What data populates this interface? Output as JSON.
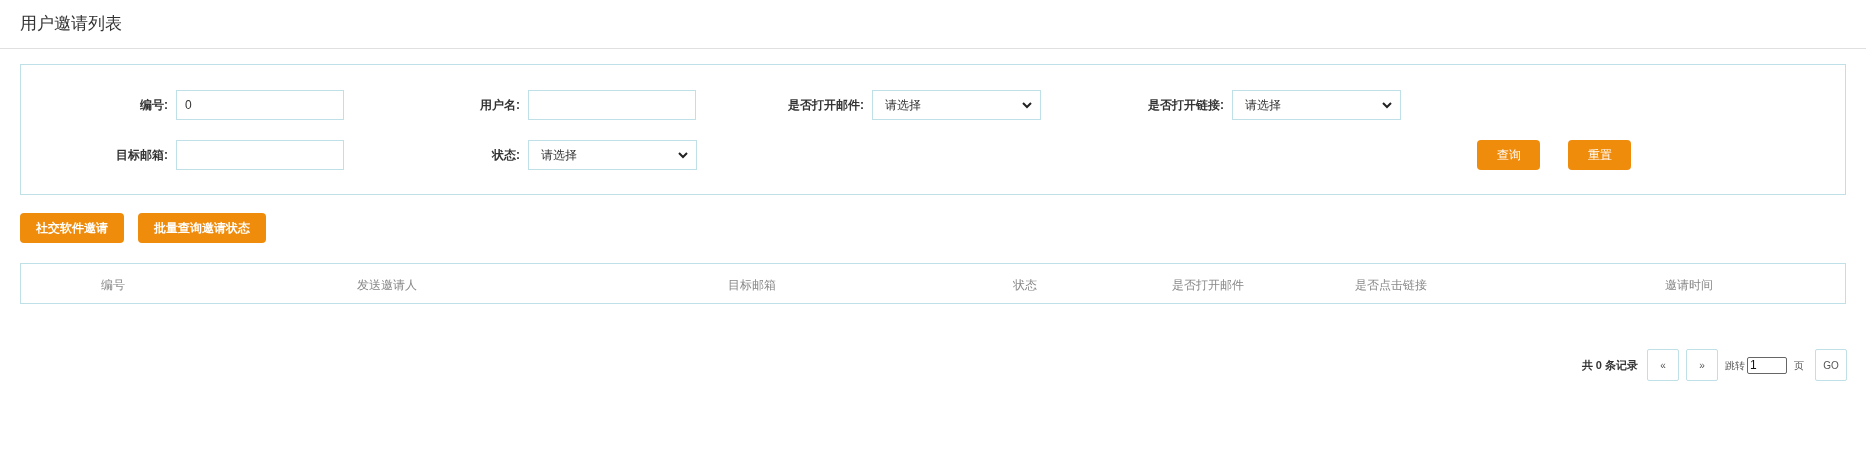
{
  "page_title": "用户邀请列表",
  "filters": [
    {
      "kind": "text",
      "label": "编号:",
      "value": "0"
    },
    {
      "kind": "text",
      "label": "用户名:"
    },
    {
      "kind": "select",
      "label": "是否打开邮件:",
      "value": "请选择"
    },
    {
      "kind": "select",
      "label": "是否打开链接:",
      "value": "请选择"
    },
    {
      "kind": "text",
      "label": "目标邮箱:"
    },
    {
      "kind": "select",
      "label": "状态:",
      "value": "请选择"
    }
  ],
  "filter_buttons": [
    "查询",
    "重置"
  ],
  "action_buttons": [
    "社交软件邀请",
    "批量查询邀请状态"
  ],
  "table": {
    "columns": [
      "编号",
      "发送邀请人",
      "目标邮箱",
      "状态",
      "是否打开邮件",
      "是否点击链接",
      "邀请时间"
    ]
  },
  "pagination": {
    "summary": "共 0 条记录",
    "prev": "«",
    "next": "»",
    "jump_label": "跳转",
    "page_value": "1",
    "page_suffix": "页",
    "go": "GO"
  }
}
